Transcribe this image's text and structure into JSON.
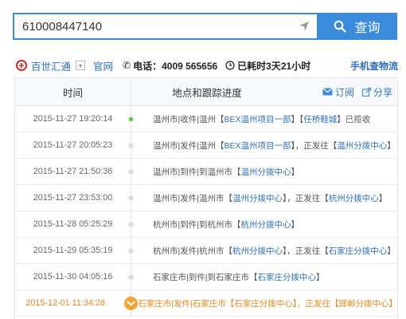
{
  "search": {
    "value": "610008447140",
    "button_label": "查询"
  },
  "info": {
    "brand_name": "百世汇通",
    "dropdown_glyph": "▾",
    "site_link": "官网",
    "phone": "电话：4009 565656",
    "elapsed": "已耗时3天21小时",
    "mobile_link": "手机查物流"
  },
  "table": {
    "header_time": "时间",
    "header_location": "地点和跟踪进度",
    "subscribe": "订阅",
    "share": "分享",
    "rows": [
      {
        "time": "2015-11-27 19:20:14",
        "pre": "温州市|收件|温州【",
        "h1": "BEX温州项目一部",
        "mid": "】【",
        "h2": "任桥鞋城",
        "post": "】已揽收"
      },
      {
        "time": "2015-11-27 20:05:23",
        "pre": "温州市|发件|温州【",
        "h1": "BEX温州项目一部",
        "mid": "】，正发往【",
        "h2": "温州分拨中心",
        "post": "】"
      },
      {
        "time": "2015-11-27 21:50:36",
        "pre": "温州市|到件|到温州市【",
        "h1": "温州分拨中心",
        "mid": "】",
        "h2": "",
        "post": ""
      },
      {
        "time": "2015-11-27 23:53:00",
        "pre": "温州市|发件|温州市【",
        "h1": "温州分拨中心",
        "mid": "】，正发往【",
        "h2": "杭州分拨中心",
        "post": "】"
      },
      {
        "time": "2015-11-28 05:25:29",
        "pre": "杭州市|到件|到杭州市【",
        "h1": "杭州分拨中心",
        "mid": "】",
        "h2": "",
        "post": ""
      },
      {
        "time": "2015-11-29 05:35:19",
        "pre": "杭州市|发件|杭州市【",
        "h1": "杭州分拨中心",
        "mid": "】，正发往【",
        "h2": "石家庄分拨中心",
        "post": "】"
      },
      {
        "time": "2015-11-30 04:05:16",
        "pre": "石家庄市|到件|到石家庄市【",
        "h1": "石家庄分拨中心",
        "mid": "】",
        "h2": "",
        "post": ""
      },
      {
        "time": "2015-12-01 11:34:28",
        "pre": "石家庄市|发件|石家庄市【",
        "h1": "石家庄分拨中心",
        "mid": "】，正发往【",
        "h2": "邯郸分拨中心",
        "post": "】"
      }
    ]
  },
  "colors": {
    "accent": "#3b8bdd",
    "link": "#2f6fba",
    "latest": "#e8891b",
    "first_dot": "#5fbf3f"
  },
  "icons": [
    "search-icon",
    "location-arrow-icon",
    "brand-logo-icon",
    "phone-icon",
    "clock-icon",
    "subscribe-mail-icon",
    "share-icon",
    "truck-icon"
  ]
}
